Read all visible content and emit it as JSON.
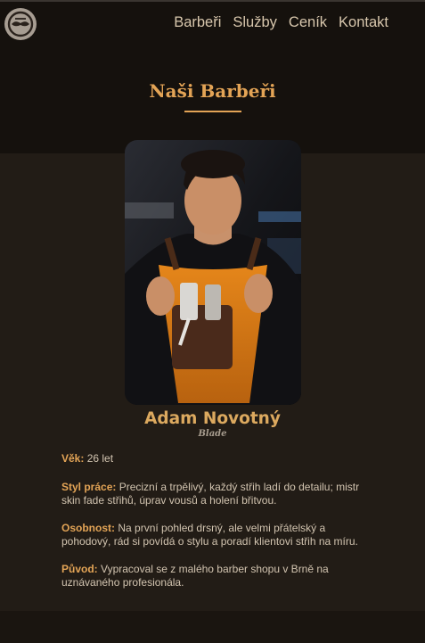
{
  "nav": {
    "items": [
      {
        "label": "Barbeři"
      },
      {
        "label": "Služby"
      },
      {
        "label": "Ceník"
      },
      {
        "label": "Kontakt"
      }
    ],
    "logo_icon": "mustache-logo-icon"
  },
  "section": {
    "title": "Naši Barbeři"
  },
  "barber": {
    "name": "Adam Novotný",
    "nickname": "Blade",
    "photo_icon": "barber-portrait-image",
    "age_label": "Věk:",
    "age_value": "26 let",
    "style_label": "Styl práce:",
    "style_value": "Precizní a trpělivý, každý střih ladí do detailu; mistr skin fade střihů, úprav vousů a holení břitvou.",
    "personality_label": "Osobnost:",
    "personality_value": "Na první pohled drsný, ale velmi přátelský a pohodový, rád si povídá o stylu a poradí klientovi střih na míru.",
    "origin_label": "Původ:",
    "origin_value": "Vypracoval se z malého barber shopu v Brně na uznávaného profesionála."
  },
  "colors": {
    "accent": "#e3a456",
    "background": "#221c16",
    "hero_background": "#15110d",
    "nav_text": "#d8c7ad",
    "body_text": "#d2c4b0"
  }
}
